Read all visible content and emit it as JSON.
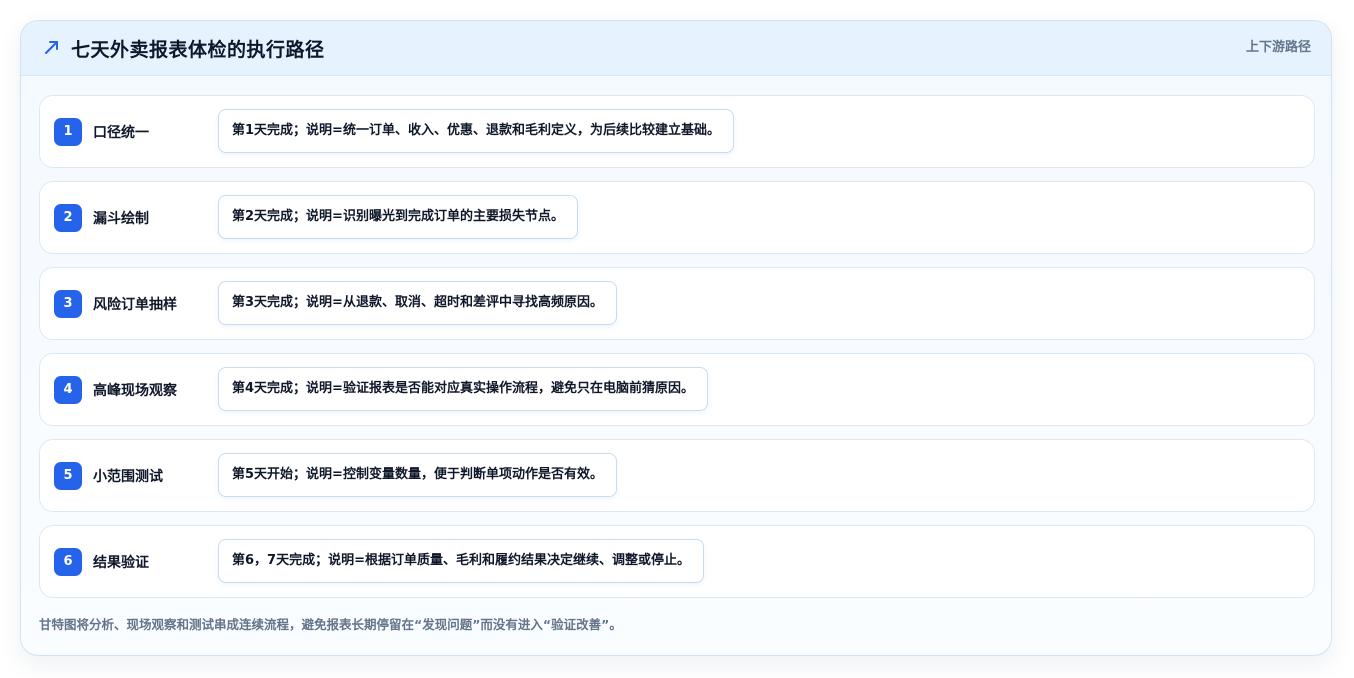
{
  "header": {
    "icon": "trend-arrow-icon",
    "title": "七天外卖报表体检的执行路径",
    "tag": "上下游路径"
  },
  "colors": {
    "accent": "#2563eb",
    "header_bg": "#e6f2fd",
    "border": "#dbe9f6"
  },
  "steps": [
    {
      "num": "1",
      "name": "口径统一",
      "desc": "第1天完成；说明=统一订单、收入、优惠、退款和毛利定义，为后续比较建立基础。"
    },
    {
      "num": "2",
      "name": "漏斗绘制",
      "desc": "第2天完成；说明=识别曝光到完成订单的主要损失节点。"
    },
    {
      "num": "3",
      "name": "风险订单抽样",
      "desc": "第3天完成；说明=从退款、取消、超时和差评中寻找高频原因。"
    },
    {
      "num": "4",
      "name": "高峰现场观察",
      "desc": "第4天完成；说明=验证报表是否能对应真实操作流程，避免只在电脑前猜原因。"
    },
    {
      "num": "5",
      "name": "小范围测试",
      "desc": "第5天开始；说明=控制变量数量，便于判断单项动作是否有效。"
    },
    {
      "num": "6",
      "name": "结果验证",
      "desc": "第6，7天完成；说明=根据订单质量、毛利和履约结果决定继续、调整或停止。"
    }
  ],
  "footnote": "甘特图将分析、现场观察和测试串成连续流程，避免报表长期停留在“发现问题”而没有进入“验证改善”。"
}
